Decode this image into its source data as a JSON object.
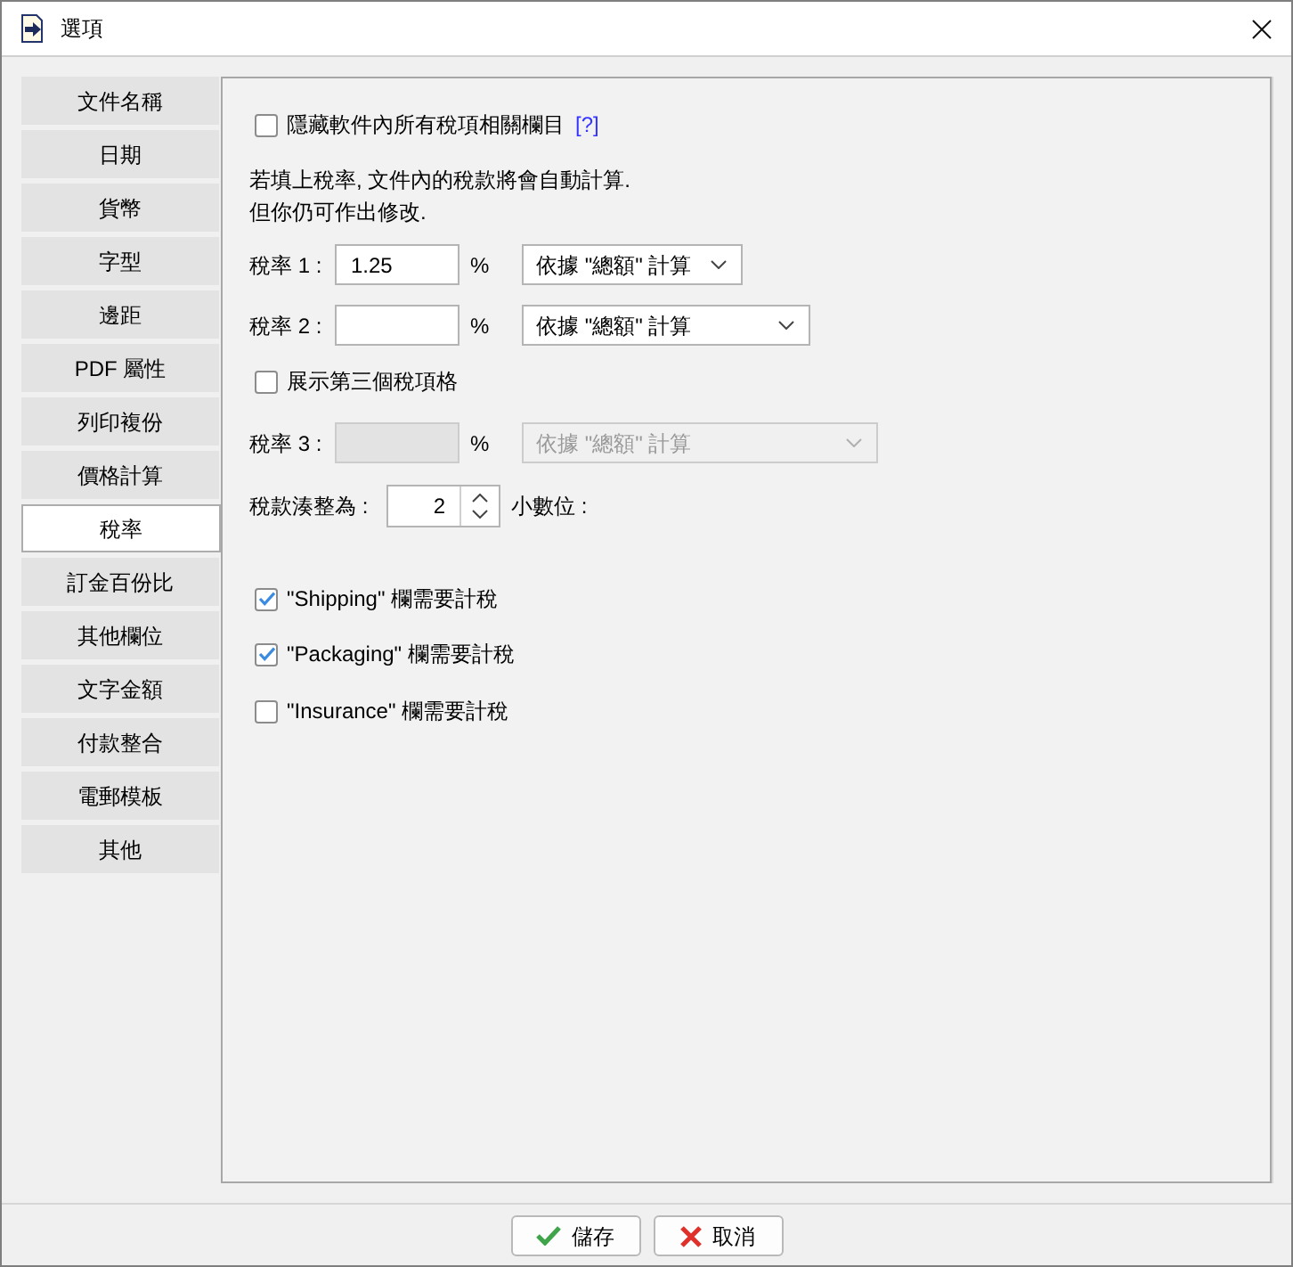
{
  "window": {
    "title": "選項"
  },
  "sidebar": {
    "items": [
      {
        "label": "文件名稱",
        "selected": false
      },
      {
        "label": "日期",
        "selected": false
      },
      {
        "label": "貨幣",
        "selected": false
      },
      {
        "label": "字型",
        "selected": false
      },
      {
        "label": "邊距",
        "selected": false
      },
      {
        "label": "PDF 屬性",
        "selected": false
      },
      {
        "label": "列印複份",
        "selected": false
      },
      {
        "label": "價格計算",
        "selected": false
      },
      {
        "label": "稅率",
        "selected": true
      },
      {
        "label": "訂金百份比",
        "selected": false
      },
      {
        "label": "其他欄位",
        "selected": false
      },
      {
        "label": "文字金額",
        "selected": false
      },
      {
        "label": "付款整合",
        "selected": false
      },
      {
        "label": "電郵模板",
        "selected": false
      },
      {
        "label": "其他",
        "selected": false
      }
    ]
  },
  "tax_panel": {
    "hide_taxes": {
      "label": "隱藏軟件內所有稅項相關欄目",
      "checked": false,
      "help_link": "[?]"
    },
    "note_lines": [
      "若填上稅率, 文件內的稅款將會自動計算.",
      "但你仍可作出修改."
    ],
    "rates": [
      {
        "label": "稅率 1 :",
        "value": "1.25",
        "unit": "%",
        "basis": "依據 \"總額\" 計算",
        "disabled": false
      },
      {
        "label": "稅率 2 :",
        "unit": "%",
        "basis": "依據 \"總額\" 計算",
        "disabled": false
      }
    ],
    "third_rate_toggle": {
      "label": "展示第三個稅項格",
      "checked": false
    },
    "third_rate": {
      "label": "稅率 3 :",
      "unit": "%",
      "basis": "依據 \"總額\" 計算",
      "disabled": true
    },
    "rounding": {
      "label": "稅款湊整為 :",
      "value": "2",
      "suffix": "小數位 :"
    },
    "taxable_fields": [
      {
        "label": "\"Shipping\" 欄需要計稅",
        "checked": true
      },
      {
        "label": "\"Packaging\" 欄需要計稅",
        "checked": true
      },
      {
        "label": "\"Insurance\" 欄需要計稅",
        "checked": false
      }
    ]
  },
  "buttons": [
    {
      "label": "儲存",
      "kind": "save"
    },
    {
      "label": "取消",
      "kind": "cancel"
    }
  ]
}
